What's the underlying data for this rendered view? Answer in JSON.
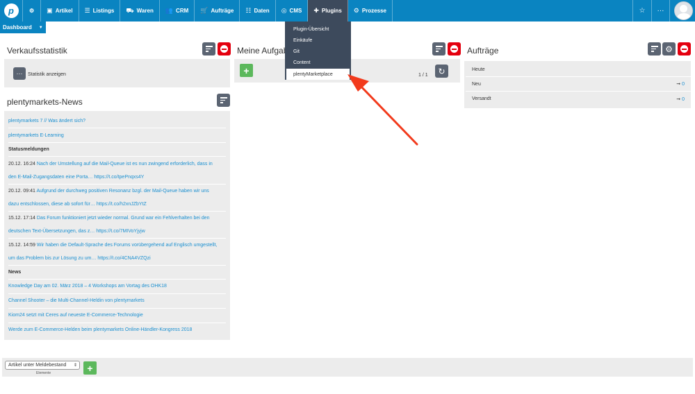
{
  "topbar": {
    "logo_letter": "p",
    "nav": [
      {
        "label": "Artikel",
        "icon": "▣"
      },
      {
        "label": "Listings",
        "icon": "☰"
      },
      {
        "label": "Waren",
        "icon": "⛟"
      },
      {
        "label": "CRM",
        "icon": "👥"
      },
      {
        "label": "Aufträge",
        "icon": "🛒"
      },
      {
        "label": "Daten",
        "icon": "☷"
      },
      {
        "label": "CMS",
        "icon": "◎"
      },
      {
        "label": "Plugins",
        "icon": "✚"
      },
      {
        "label": "Prozesse",
        "icon": "⚙"
      }
    ],
    "settings_icon": "⚙",
    "star_icon": "☆",
    "more_icon": "···"
  },
  "dashboard_tab": {
    "label": "Dashboard",
    "caret": "▼"
  },
  "plugins_menu": {
    "items": [
      "Plugin-Übersicht",
      "Einkäufe",
      "Git",
      "Content",
      "plentyMarketplace"
    ]
  },
  "verkaufsstatistik": {
    "title": "Verkaufsstatistik",
    "button_icon": "···",
    "show_label": "Statistik anzeigen"
  },
  "news": {
    "title": "plentymarkets-News",
    "rows": [
      {
        "type": "link",
        "text": "plentymarkets 7 // Was ändert sich?"
      },
      {
        "type": "link",
        "text": "plentymarkets E-Learning"
      },
      {
        "type": "head",
        "text": "Statusmeldungen"
      },
      {
        "type": "status",
        "date": "20.12. 16:24",
        "line1": "Nach der Umstellung auf die Mail-Queue ist es nun zwingend erforderlich, dass in",
        "line2": "den E-Mail-Zugangsdaten eine Porta… https://t.co/tpePnqxs4Y"
      },
      {
        "type": "status",
        "date": "20.12. 09:41",
        "line1": "Aufgrund der durchweg positiven Resonanz bzgl. der Mail-Queue haben wir uns",
        "line2": "dazu entschlossen, diese ab sofort für… https://t.co/h2xnJZbYtZ"
      },
      {
        "type": "status",
        "date": "15.12. 17:14",
        "line1": "Das Forum funktioniert jetzt wieder normal. Grund war ein Fehlverhalten bei den",
        "line2": "deutschen Text-Übersetzungen, das z… https://t.co/7MIVoYjyjw"
      },
      {
        "type": "status",
        "date": "15.12. 14:59",
        "line1": "Wir haben die Default-Sprache des Forums vorübergehend auf Englisch umgestellt,",
        "line2": "um das Problem bis zur Lösung zu um… https://t.co/4CNA4VZQzi"
      },
      {
        "type": "head",
        "text": "News"
      },
      {
        "type": "link",
        "text": "Knowledge Day am 02. März 2018 – 4 Workshops am Vortag des OHK18"
      },
      {
        "type": "link",
        "text": "Channel Shooter – die Multi-Channel-Heldin von plentymarkets"
      },
      {
        "type": "link",
        "text": "Kiom24 setzt mit Ceres auf neueste E-Commerce-Technologie"
      },
      {
        "type": "link",
        "text": "Werde zum E-Commerce-Helden beim plentymarkets Online-Händler-Kongress 2018"
      }
    ]
  },
  "aufgaben": {
    "title": "Meine Aufgaben",
    "add_icon": "+",
    "pagination": "1 / 1",
    "refresh_icon": "↻"
  },
  "auftraege": {
    "title": "Aufträge",
    "rows": [
      {
        "label": "Heute",
        "value": "",
        "arrow": ""
      },
      {
        "label": "Neu",
        "value": "0",
        "arrow": "➞"
      },
      {
        "label": "Versandt",
        "value": "0",
        "arrow": "➞"
      }
    ]
  },
  "bottom": {
    "select_value": "Artikel unter Meldebestand",
    "select_caret": "⇕",
    "elements_label": "Elemente",
    "add_icon": "+"
  },
  "colors": {
    "brand": "#0a84c1",
    "menu_dark": "#3d4a5c",
    "danger": "#e4000f",
    "success": "#5cb85c",
    "link": "#1a8fd0",
    "annotation_arrow": "#f23a1c"
  }
}
